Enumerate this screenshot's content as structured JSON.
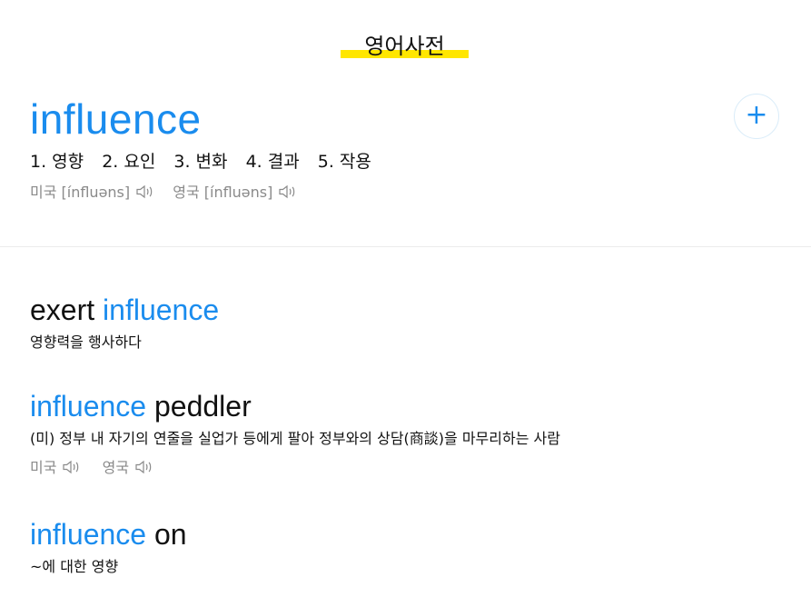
{
  "header": {
    "title": "영어사전"
  },
  "entry": {
    "word": "influence",
    "add_label": "+",
    "meanings": [
      "1. 영향",
      "2. 요인",
      "3. 변화",
      "4. 결과",
      "5. 작용"
    ],
    "pronunciations": [
      {
        "label": "미국 [ínfluəns]"
      },
      {
        "label": "영국 [ínfluəns]"
      }
    ]
  },
  "phrases": [
    {
      "pre": "exert ",
      "highlight": "influence",
      "post": "",
      "meaning": "영향력을 행사하다"
    },
    {
      "pre": "",
      "highlight": "influence",
      "post": " peddler",
      "meaning": "(미) 정부 내 자기의 연줄을 실업가 등에게 팔아 정부와의 상담(商談)을 마무리하는 사람",
      "pron": [
        "미국",
        "영국"
      ]
    },
    {
      "pre": "",
      "highlight": "influence",
      "post": " on",
      "meaning": "~에 대한 영향"
    }
  ],
  "colors": {
    "accent": "#1a8cee",
    "highlight": "#ffe600",
    "muted": "#8a8a8a"
  },
  "icons": {
    "speaker": "speaker-icon",
    "add": "plus-icon"
  }
}
